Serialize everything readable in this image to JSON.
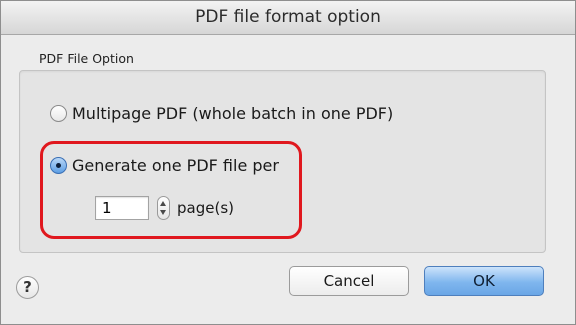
{
  "window": {
    "title": "PDF file format option"
  },
  "group": {
    "label": "PDF File Option"
  },
  "options": {
    "multipage": {
      "label": "Multipage PDF (whole batch in one PDF)",
      "selected": false
    },
    "per_pages": {
      "label": "Generate one PDF file per",
      "selected": true
    }
  },
  "pages": {
    "value": "1",
    "unit_label": "page(s)"
  },
  "help": {
    "glyph": "?",
    "icon": "help-icon"
  },
  "buttons": {
    "cancel": "Cancel",
    "ok": "OK"
  },
  "colors": {
    "highlight": "#e0181e",
    "accent": "#5d9ee4"
  }
}
